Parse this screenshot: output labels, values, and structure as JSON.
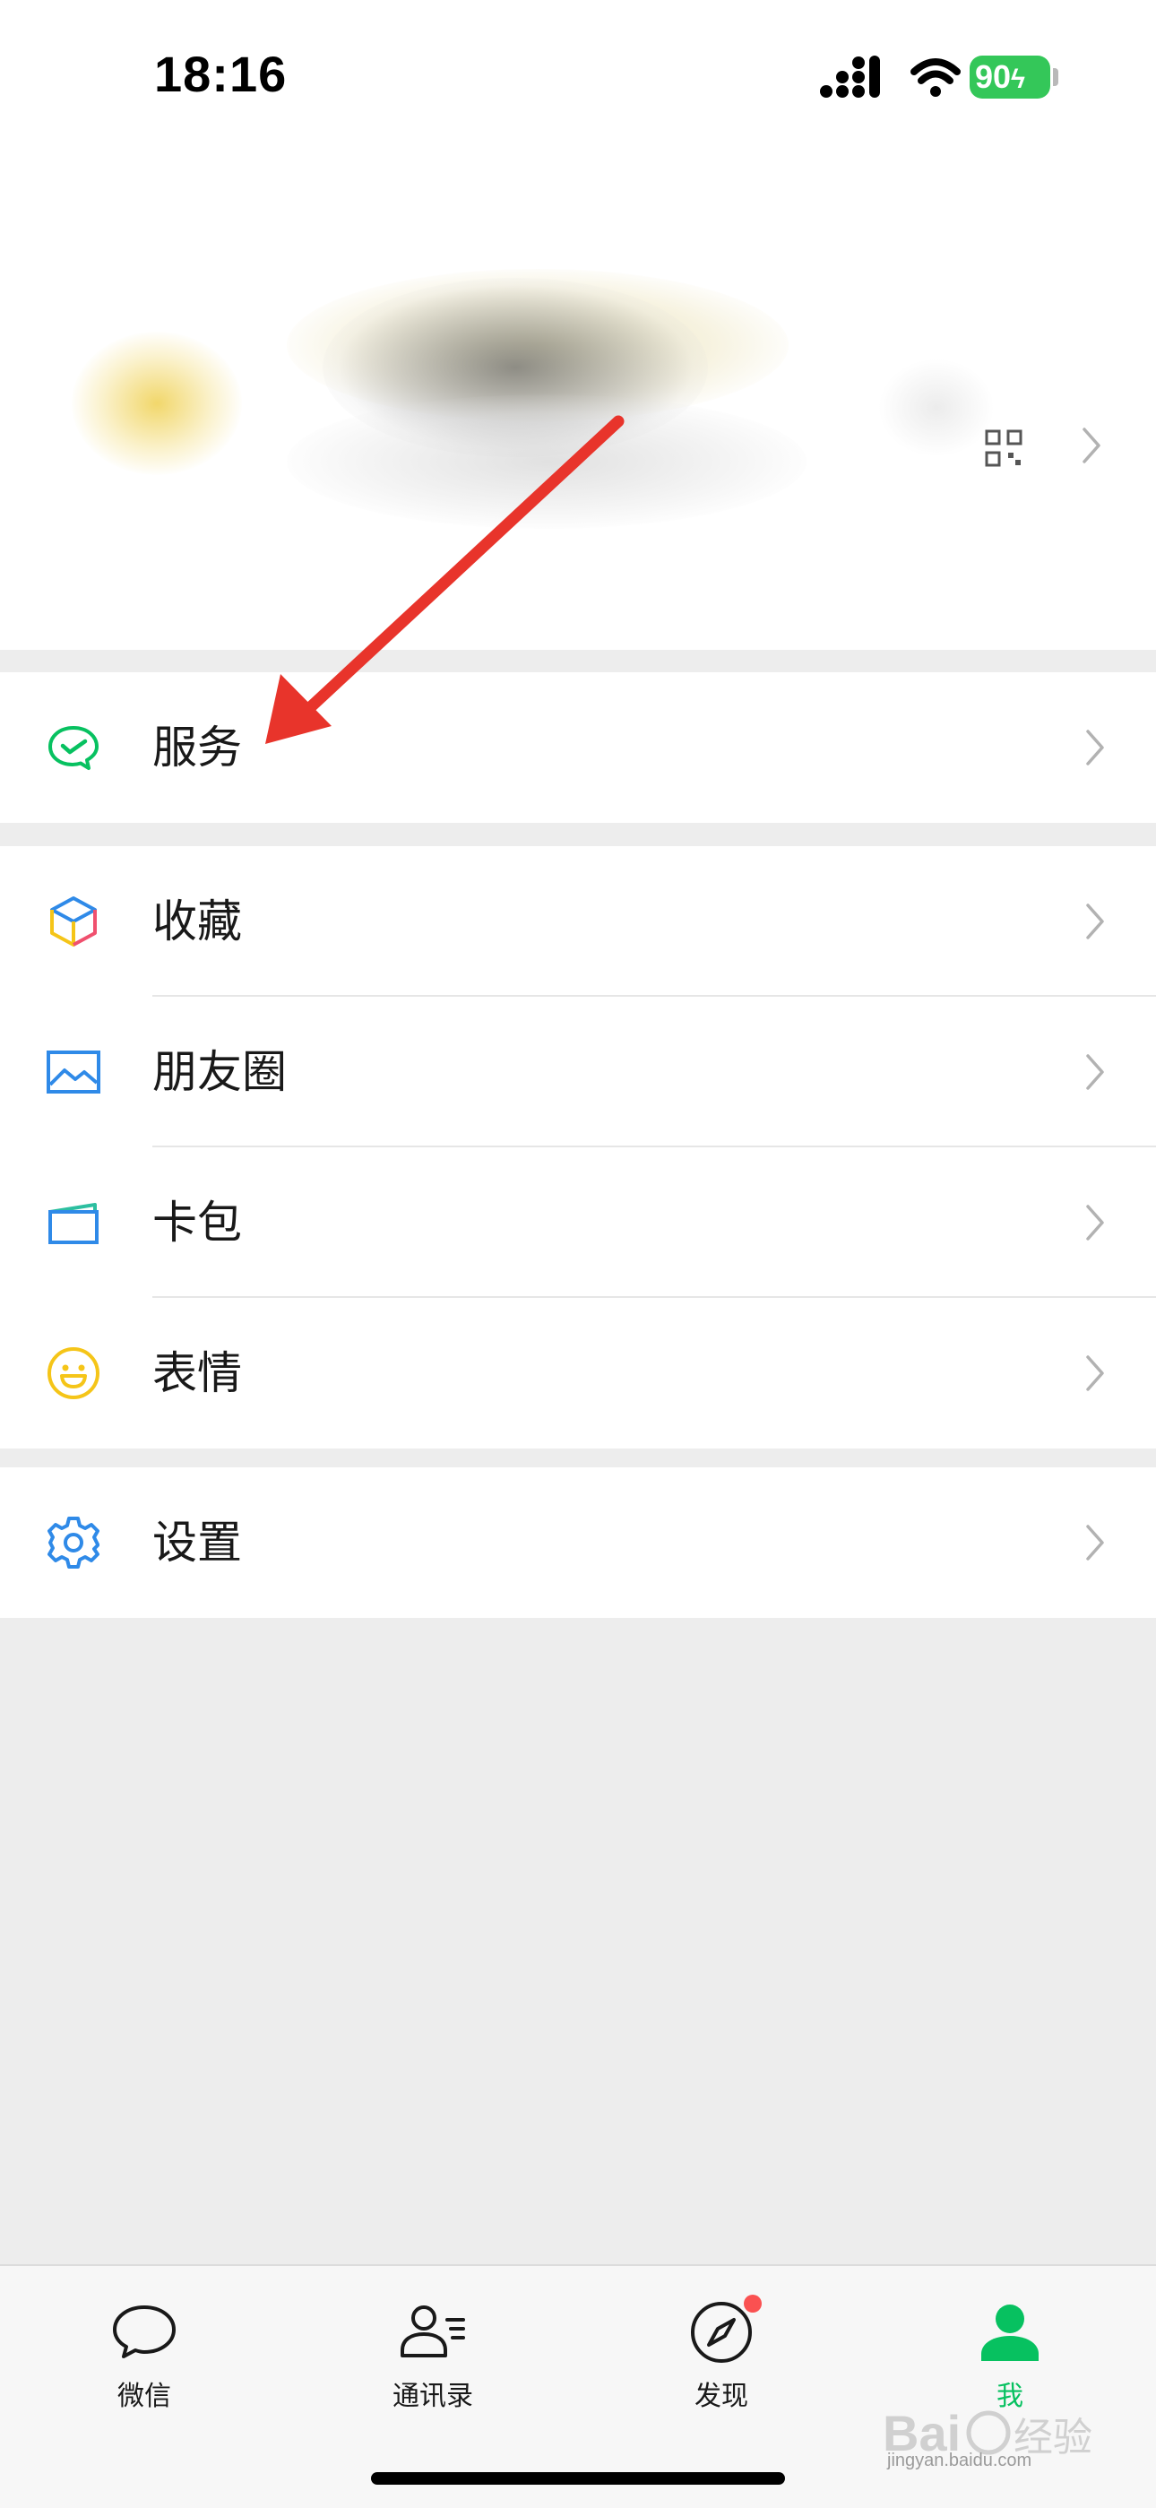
{
  "status_bar": {
    "time": "18:16",
    "battery": "90",
    "icons": [
      "signal-icon",
      "wifi-icon",
      "battery-charging-icon"
    ]
  },
  "profile": {
    "name_obscured": true,
    "icons": [
      "qr-code-icon",
      "chevron-right-icon"
    ]
  },
  "menu": {
    "service": {
      "label": "服务",
      "icon": "wechat-pay-icon"
    },
    "group2": [
      {
        "label": "收藏",
        "icon": "favorites-cube-icon"
      },
      {
        "label": "朋友圈",
        "icon": "moments-photo-icon"
      },
      {
        "label": "卡包",
        "icon": "card-wallet-icon"
      },
      {
        "label": "表情",
        "icon": "sticker-smiley-icon"
      }
    ],
    "settings": {
      "label": "设置",
      "icon": "gear-icon"
    }
  },
  "tab_bar": {
    "tabs": [
      {
        "label": "微信",
        "icon": "chat-bubble-icon",
        "active": false
      },
      {
        "label": "通讯录",
        "icon": "contacts-icon",
        "active": false
      },
      {
        "label": "发现",
        "icon": "compass-icon",
        "active": false,
        "badge": true
      },
      {
        "label": "我",
        "icon": "person-icon",
        "active": true
      }
    ]
  },
  "colors": {
    "accent_green": "#07c160",
    "badge_red": "#fa5151",
    "annotation_red": "#e8342b",
    "background": "#ededed"
  },
  "watermark": {
    "domain": "jingyan.baidu.com"
  }
}
